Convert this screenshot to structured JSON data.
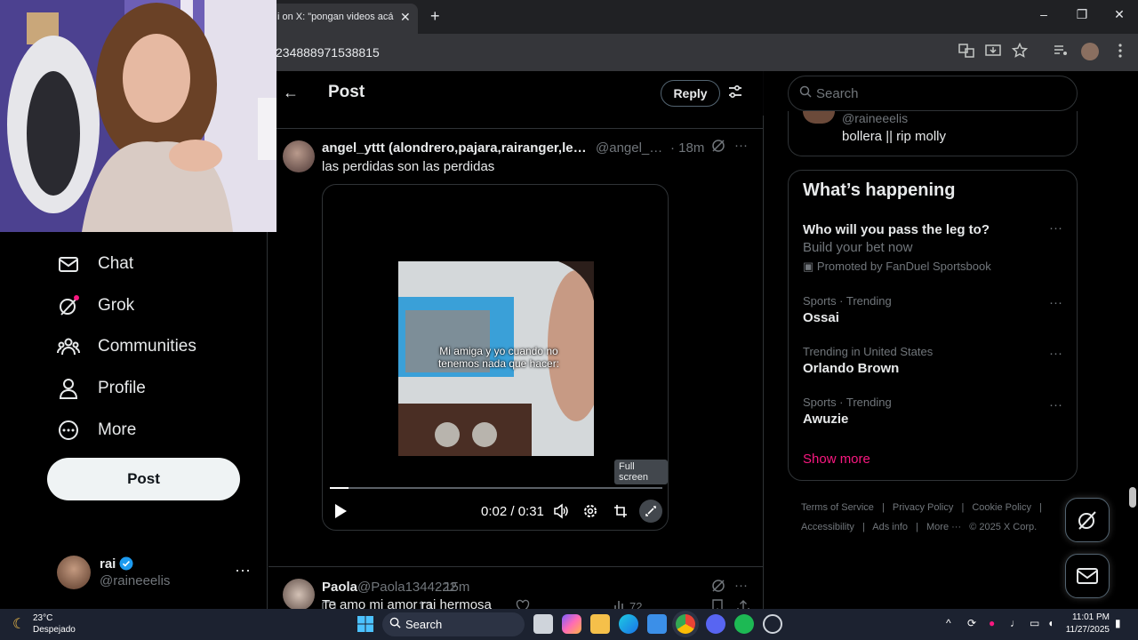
{
  "browser": {
    "tab_title": "i on X: \"pongan videos acá para un",
    "tab_close": "✕",
    "new_tab": "+",
    "address": "234888971538815",
    "win_minimize": "–",
    "win_restore": "❐",
    "win_close": "✕"
  },
  "nav": {
    "items": [
      {
        "label": "Chat",
        "icon": "mail-icon"
      },
      {
        "label": "Grok",
        "icon": "grok-icon"
      },
      {
        "label": "Communities",
        "icon": "communities-icon"
      },
      {
        "label": "Profile",
        "icon": "profile-icon"
      },
      {
        "label": "More",
        "icon": "more-circle-icon"
      }
    ],
    "post_button": "Post",
    "account": {
      "name": "rai",
      "handle": "@raineeelis",
      "more": "···"
    }
  },
  "header": {
    "back": "←",
    "title": "Post",
    "reply_button": "Reply"
  },
  "tweet": {
    "name": "angel_yttt (alondrero,pajara,rairanger,lesbi...",
    "handle": "@angel_ytt...",
    "time": "· 18m",
    "more": "···",
    "text": "las perdidas son las perdidas",
    "video": {
      "caption": "Mi amiga y yo cuando no tenemos nada que hacer:",
      "tooltip": "Full screen",
      "time": "0:02 / 0:31",
      "progress": 0.055
    },
    "actions": {
      "views": "72"
    }
  },
  "tweet2": {
    "name": "Paola",
    "handle": "@Paola1344222",
    "time": "· 15m",
    "text": "Te amo mi amor rai hermosa"
  },
  "sidebar": {
    "search_placeholder": "Search",
    "profile_card": {
      "handle": "@raineeelis",
      "bio": "bollera || rip molly"
    },
    "trends_title": "What’s happening",
    "promo": {
      "title": "Who will you pass the leg to?",
      "subtitle": "Build your bet now",
      "promoted_by": "Promoted by FanDuel Sportsbook"
    },
    "trends": [
      {
        "context": "Sports · Trending",
        "name": "Ossai"
      },
      {
        "context": "Trending in United States",
        "name": "Orlando Brown"
      },
      {
        "context": "Sports · Trending",
        "name": "Awuzie"
      }
    ],
    "trend_more": "···",
    "show_more": "Show more",
    "footer_row1": [
      "Terms of Service",
      "|",
      "Privacy Policy",
      "|",
      "Cookie Policy",
      "|"
    ],
    "footer_row2": [
      "Accessibility",
      "|",
      "Ads info",
      "|",
      "More ···",
      "© 2025 X Corp."
    ]
  },
  "taskbar": {
    "temp": "23°C",
    "weather": "Despejado",
    "search_placeholder": "Search",
    "time": "11:01 PM",
    "date": "11/27/2025"
  },
  "colors": {
    "accent_pink": "#f91880",
    "verified_blue": "#1d9bf0"
  }
}
